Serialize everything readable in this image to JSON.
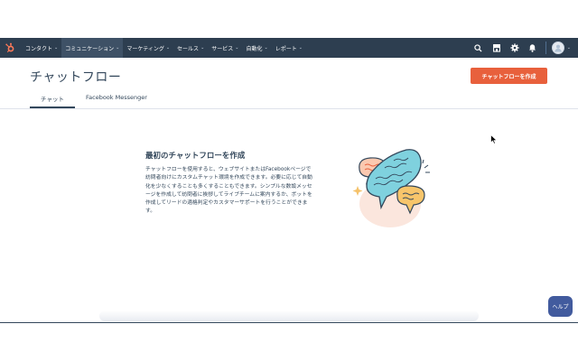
{
  "nav": {
    "items": [
      {
        "label": "コンタクト",
        "active": false
      },
      {
        "label": "コミュニケーション",
        "active": true
      },
      {
        "label": "マーケティング",
        "active": false
      },
      {
        "label": "セールス",
        "active": false
      },
      {
        "label": "サービス",
        "active": false
      },
      {
        "label": "自動化",
        "active": false
      },
      {
        "label": "レポート",
        "active": false
      }
    ],
    "icons": [
      "search-icon",
      "marketplace-icon",
      "settings-icon",
      "notifications-icon"
    ],
    "brand_color": "#ff7a59",
    "bar_color": "#2d3e50"
  },
  "header": {
    "title": "チャットフロー",
    "create_button": "チャットフローを作成",
    "create_button_color": "#e8603c"
  },
  "tabs": [
    {
      "label": "チャット",
      "active": true
    },
    {
      "label": "Facebook Messenger",
      "active": false
    }
  ],
  "empty_state": {
    "title": "最初のチャットフローを作成",
    "lines": [
      "チャットフローを使用すると、ウェブサイトまたはFacebookページで",
      "訪問者向けにカスタムチャット環境を作成できます。必要に応じて自動",
      "化を少なくすることも多くすることもできます。シンプルな数設メッセ",
      "ージを作成して訪問者に挨拶してライブチームに案内するか、ボットを",
      "作成してリードの適格判定やカスタマーサポートを行うことができま",
      "す。"
    ]
  },
  "help": {
    "label": "ヘルプ",
    "color": "#425b9e"
  }
}
